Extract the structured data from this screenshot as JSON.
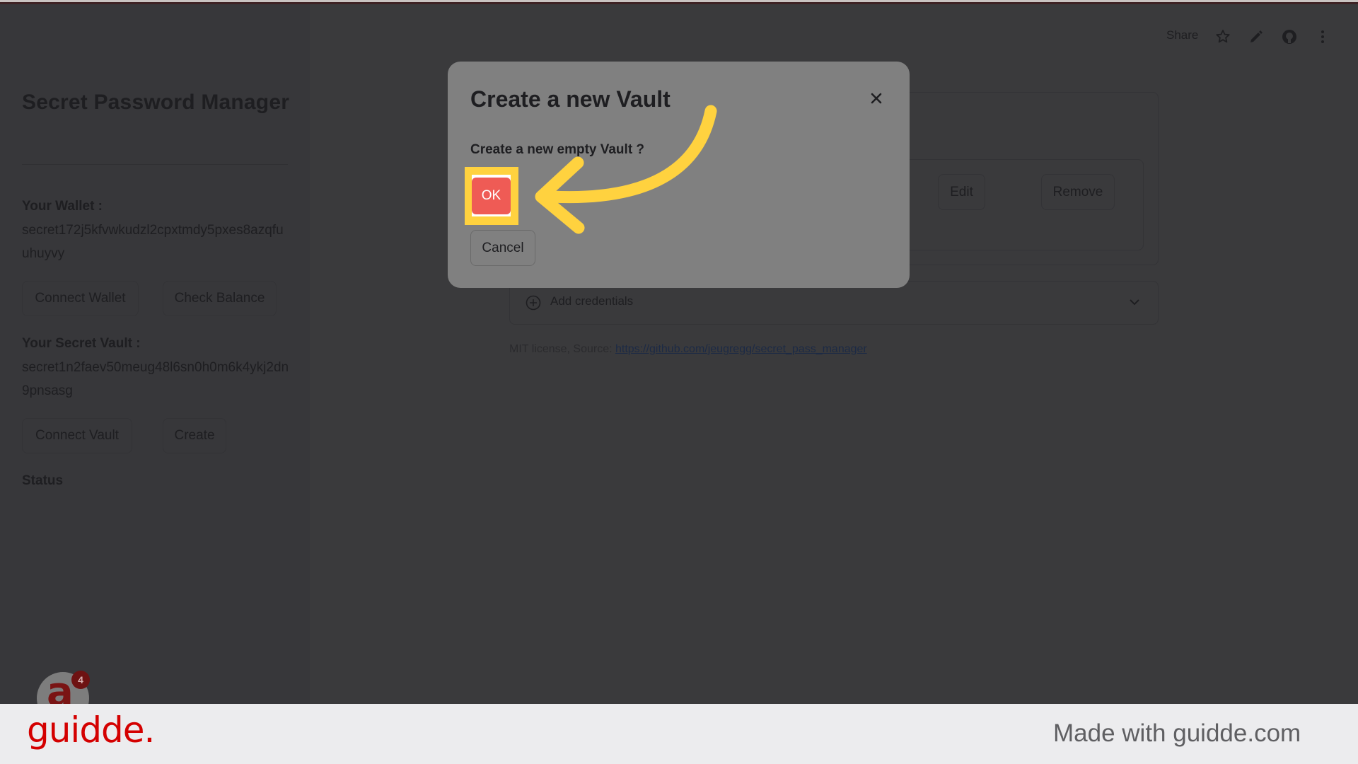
{
  "app": {
    "title": "Secret Password Manager"
  },
  "topbar": {
    "share_label": "Share",
    "icons": [
      "star-icon",
      "pencil-icon",
      "github-icon",
      "kebab-menu-icon"
    ]
  },
  "sidebar": {
    "wallet_label": "Your Wallet :",
    "wallet_address": "secret172j5kfvwkudzl2cpxtmdy5pxes8azqfuuhuyvy",
    "connect_wallet_label": "Connect Wallet",
    "check_balance_label": "Check Balance",
    "vault_label": "Your Secret Vault :",
    "vault_address": "secret1n2faev50meug48l6sn0h0m6k4ykj2dn9pnsasg",
    "connect_vault_label": "Connect Vault",
    "create_label": "Create",
    "status_label": "Status"
  },
  "main": {
    "edit_label": "Edit",
    "remove_label": "Remove",
    "add_credentials_label": "Add credentials",
    "license_text": "MIT license, Source: ",
    "license_link": "https://github.com/jeugregg/secret_pass_manager"
  },
  "modal": {
    "title": "Create a new Vault",
    "message": "Create a new empty Vault ?",
    "ok_label": "OK",
    "cancel_label": "Cancel"
  },
  "overlay": {
    "highlight_color": "#ffd23f",
    "arrow_color": "#ffd23f",
    "avatar_badge_count": "4",
    "avatar_glyph": "a"
  },
  "footer": {
    "brand": "guidde.",
    "made_with": "Made with guidde.com"
  }
}
